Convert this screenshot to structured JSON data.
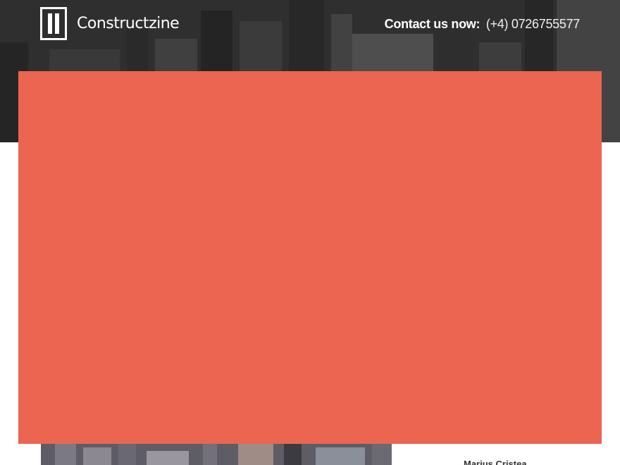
{
  "header": {
    "brand": "Constructzine",
    "contact_label": "Contact us now:",
    "contact_phone": "(+4) 0726755577"
  },
  "sidebar": {
    "author_name": "Marius Cristea"
  },
  "colors": {
    "overlay": "#ec6550",
    "header_text": "#ffffff"
  },
  "icons": {
    "logo": "constructzine-logo-icon"
  }
}
